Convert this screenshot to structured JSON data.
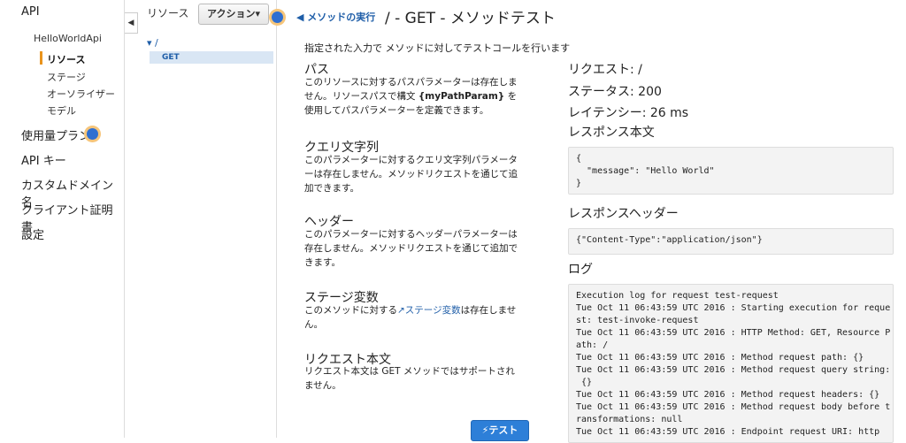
{
  "sidebar": {
    "api_label": "API",
    "api_name": "HelloWorldApi",
    "sub_items": [
      "リソース",
      "ステージ",
      "オーソライザー",
      "モデル"
    ],
    "items": [
      "使用量プラン",
      "API キー",
      "カスタムドメイン名",
      "クライアント証明書",
      "設定"
    ],
    "collapse_glyph": "◀"
  },
  "tree": {
    "header": "リソース",
    "action_label": "アクション▾",
    "root_label": "▾ /",
    "method": "GET"
  },
  "main": {
    "back_label": "◀ メソッドの実行",
    "title": "/ - GET - メソッドテスト",
    "intro": "指定された入力で メソッドに対してテストコールを行います",
    "path": {
      "title": "パス",
      "body_1": "このリソースに対するパスパラメーターは存在しません。リソースパスで構文 ",
      "body_bold": "{myPathParam}",
      "body_2": " を使用してパスパラメーターを定義できます。"
    },
    "query": {
      "title": "クエリ文字列",
      "body": "このパラメーターに対するクエリ文字列パラメーターは存在しません。メソッドリクエストを通じて追加できます。"
    },
    "headers": {
      "title": "ヘッダー",
      "body": "このパラメーターに対するヘッダーパラメーターは存在しません。メソッドリクエストを通じて追加できます。"
    },
    "stage": {
      "title": "ステージ変数",
      "body_1": "このメソッドに対する",
      "link": "↗ステージ変数",
      "body_2": "は存在しません。"
    },
    "request_body": {
      "title": "リクエスト本文",
      "body": "リクエスト本文は GET メソッドではサポートされません。"
    },
    "test_label": "⚡テスト"
  },
  "result": {
    "request": "リクエスト: /",
    "status": "ステータス: 200",
    "latency": "レイテンシー: 26 ms",
    "body_title": "レスポンス本文",
    "body_code": "{\n  \"message\": \"Hello World\"\n}",
    "headers_title": "レスポンスヘッダー",
    "headers_code": "{\"Content-Type\":\"application/json\"}",
    "log_title": "ログ",
    "log_lines": [
      "Execution log for request test-request",
      "Tue Oct 11 06:43:59 UTC 2016 : Starting execution for reque",
      "st: test-invoke-request",
      "Tue Oct 11 06:43:59 UTC 2016 : HTTP Method: GET, Resource P",
      "ath: /",
      "Tue Oct 11 06:43:59 UTC 2016 : Method request path: {}",
      "Tue Oct 11 06:43:59 UTC 2016 : Method request query string:",
      " {}",
      "Tue Oct 11 06:43:59 UTC 2016 : Method request headers: {}",
      "Tue Oct 11 06:43:59 UTC 2016 : Method request body before t",
      "ransformations: null",
      "Tue Oct 11 06:43:59 UTC 2016 : Endpoint request URI: http"
    ]
  }
}
